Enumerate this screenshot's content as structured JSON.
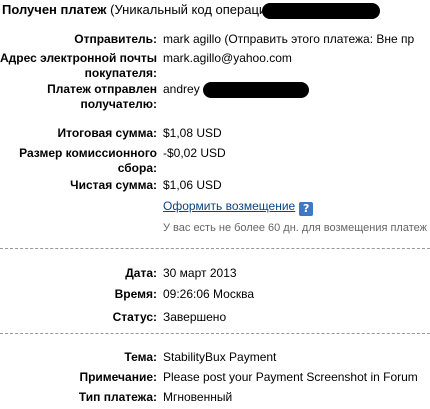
{
  "header": {
    "title_bold": "Получен платеж",
    "title_rest": "(Уникальный код операции"
  },
  "sender": {
    "label": "Отправитель:",
    "value": "mark agillo (Отправить этого платежа: Вне пр"
  },
  "email": {
    "label_line1": "Адрес электронной почты",
    "label_line2": "покупателя:",
    "value": "mark.agillo@yahoo.com"
  },
  "recipient": {
    "label_line1": "Платеж отправлен",
    "label_line2": "получателю:",
    "value": "andrey"
  },
  "totals": {
    "gross_label": "Итоговая сумма:",
    "gross_value": "$1,08 USD",
    "fee_label_line1": "Размер комиссионного",
    "fee_label_line2": "сбора:",
    "fee_value": "-$0,02 USD",
    "net_label": "Чистая сумма:",
    "net_value": "$1,06 USD"
  },
  "refund": {
    "link_text": "Оформить возмещение",
    "help_icon": "question-mark-icon",
    "note": "У вас есть не более 60 дн. для возмещения платеж"
  },
  "details": {
    "date_label": "Дата:",
    "date_value": "30 март 2013",
    "time_label": "Время:",
    "time_value": "09:26:06 Москва",
    "status_label": "Статус:",
    "status_value": "Завершено"
  },
  "info": {
    "subject_label": "Тема:",
    "subject_value": "StabilityBux Payment",
    "memo_label": "Примечание:",
    "memo_value": "Please post your Payment Screenshot in Forum",
    "type_label": "Тип платежа:",
    "type_value": "Мгновенный"
  },
  "colors": {
    "link": "#084482",
    "help_icon_bg": "#3f78c4",
    "divider": "#999999"
  }
}
